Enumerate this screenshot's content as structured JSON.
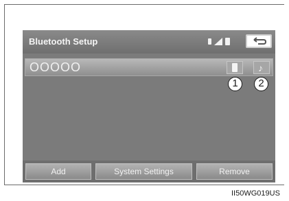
{
  "screen": {
    "title": "Bluetooth Setup",
    "status_icons": [
      "bluetooth-icon",
      "signal-strength-icon",
      "battery-icon"
    ],
    "back_icon": "return-arrow-icon",
    "device": {
      "name": "OOOOO",
      "phone_icon": "phone-icon",
      "music_icon": "music-note-icon"
    },
    "buttons": {
      "add": "Add",
      "system_settings": "System Settings",
      "remove": "Remove"
    }
  },
  "callouts": {
    "one": "1",
    "two": "2"
  },
  "figure_code": "II50WG019US",
  "colors": {
    "screen_bg": "#7b7b7b",
    "button_text": "#f2f2f2"
  }
}
